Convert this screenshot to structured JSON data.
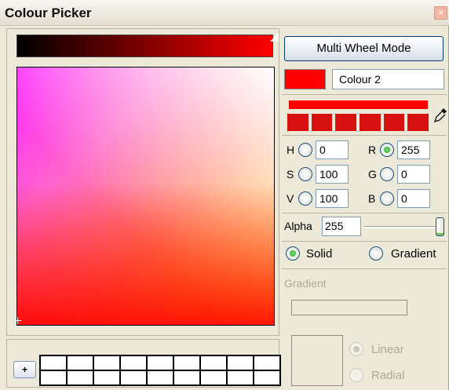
{
  "window": {
    "title": "Colour Picker",
    "close_glyph": "×"
  },
  "colors": {
    "current": "#ff0000",
    "accent_green": "#21a121"
  },
  "toolbar": {
    "mode_button": "Multi Wheel Mode",
    "add_swatch": "+"
  },
  "colour": {
    "name": "Colour 2"
  },
  "hsv": {
    "h_label": "H",
    "h_value": "0",
    "s_label": "S",
    "s_value": "100",
    "v_label": "V",
    "v_value": "100"
  },
  "rgb": {
    "r_label": "R",
    "r_value": "255",
    "g_label": "G",
    "g_value": "0",
    "b_label": "B",
    "b_value": "0"
  },
  "alpha": {
    "label": "Alpha",
    "value": "255",
    "level": 1.0
  },
  "fill_mode": {
    "solid": "Solid",
    "gradient": "Gradient",
    "selected": "Solid"
  },
  "gradient": {
    "heading": "Gradient",
    "linear": "Linear",
    "radial": "Radial"
  },
  "icons": {
    "eyedropper": "eyedropper-icon",
    "close": "close-icon"
  }
}
